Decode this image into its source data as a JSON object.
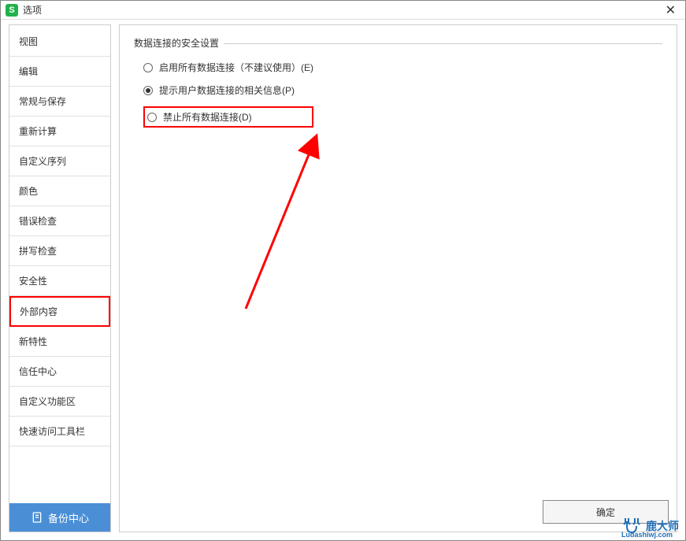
{
  "window": {
    "title": "选项",
    "icon_letter": "S"
  },
  "sidebar": {
    "items": [
      {
        "label": "视图"
      },
      {
        "label": "编辑"
      },
      {
        "label": "常规与保存"
      },
      {
        "label": "重新计算"
      },
      {
        "label": "自定义序列"
      },
      {
        "label": "颜色"
      },
      {
        "label": "错误检查"
      },
      {
        "label": "拼写检查"
      },
      {
        "label": "安全性"
      },
      {
        "label": "外部内容",
        "selected": true
      },
      {
        "label": "新特性"
      },
      {
        "label": "信任中心"
      },
      {
        "label": "自定义功能区"
      },
      {
        "label": "快速访问工具栏"
      }
    ],
    "backup_label": "备份中心"
  },
  "content": {
    "group_title": "数据连接的安全设置",
    "options": [
      {
        "label": "启用所有数据连接（不建议使用）(E)",
        "checked": false
      },
      {
        "label": "提示用户数据连接的相关信息(P)",
        "checked": true
      },
      {
        "label": "禁止所有数据连接(D)",
        "checked": false,
        "highlighted": true
      }
    ]
  },
  "buttons": {
    "ok": "确定"
  },
  "watermark": {
    "name": "鹿大师",
    "url": "Ludashiwj.com"
  }
}
